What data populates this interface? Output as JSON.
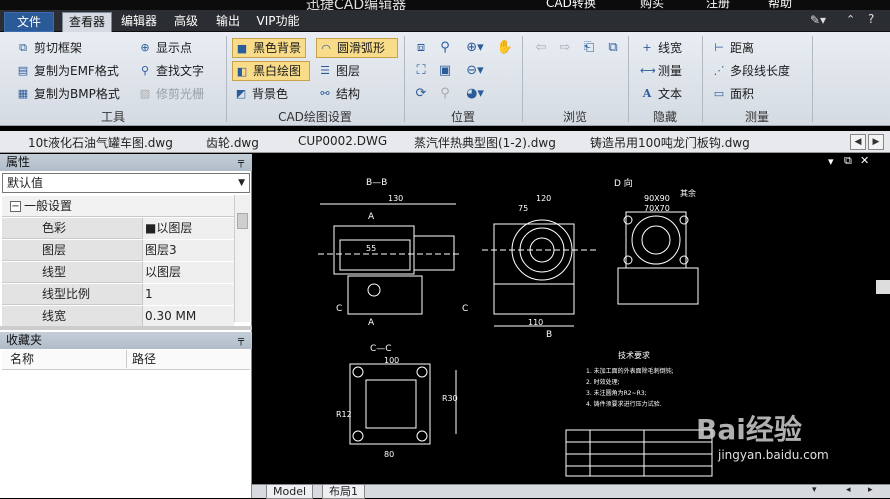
{
  "window": {
    "title": "迅捷CAD编辑器",
    "right_items": [
      "CAD转换",
      "购买",
      "注册",
      "帮助"
    ]
  },
  "menu_tabs": [
    "文件",
    "查看器",
    "编辑器",
    "高级",
    "输出",
    "VIP功能"
  ],
  "ribbon": {
    "tools": {
      "label": "工具",
      "buttons": [
        "剪切框架",
        "显示点",
        "复制为EMF格式",
        "查找文字",
        "复制为BMP格式",
        "修剪光栅"
      ]
    },
    "cad_settings": {
      "label": "CAD绘图设置",
      "buttons": [
        "黑色背景",
        "圆滑弧形",
        "黑白绘图",
        "图层",
        "背景色",
        "结构"
      ]
    },
    "position": {
      "label": "位置"
    },
    "browse": {
      "label": "浏览"
    },
    "hidden": {
      "label": "隐藏",
      "buttons": [
        "线宽",
        "测量",
        "文本"
      ]
    },
    "measure": {
      "label": "测量",
      "buttons": [
        "距离",
        "多段线长度",
        "面积"
      ]
    }
  },
  "doc_tabs": [
    "10t液化石油气罐车图.dwg",
    "齿轮.dwg",
    "CUP0002.DWG",
    "蒸汽伴热典型图(1-2).dwg",
    "铸造吊用100吨龙门板钩.dwg"
  ],
  "properties": {
    "header": "属性",
    "select_value": "默认值",
    "group": "一般设置",
    "rows": [
      {
        "key": "色彩",
        "value": "■以图层"
      },
      {
        "key": "图层",
        "value": "图层3"
      },
      {
        "key": "线型",
        "value": "以图层"
      },
      {
        "key": "线型比例",
        "value": "1"
      },
      {
        "key": "线宽",
        "value": "0.30 MM"
      }
    ]
  },
  "favorites": {
    "header": "收藏夹",
    "col_name": "名称",
    "col_path": "路径"
  },
  "layout_tabs": [
    "Model",
    "布局1"
  ],
  "watermark": {
    "brand": "Bai经验",
    "url": "jingyan.baidu.com"
  },
  "drawing": {
    "views": [
      "B—B",
      "A",
      "A",
      "B",
      "D 向",
      "C—C"
    ],
    "dims": [
      "130",
      "120",
      "75",
      "110",
      "90X90",
      "70X70",
      "100",
      "80",
      "55",
      "R30",
      "R12",
      "C",
      "C",
      "其余"
    ],
    "notes_title": "技术要求",
    "notes": [
      "1. 未加工面的外表面除毛刺倒钝;",
      "2. 时效处理;",
      "3. 未注圆角为R2~R3;",
      "4. 铸件须要求进行压力试验."
    ]
  }
}
